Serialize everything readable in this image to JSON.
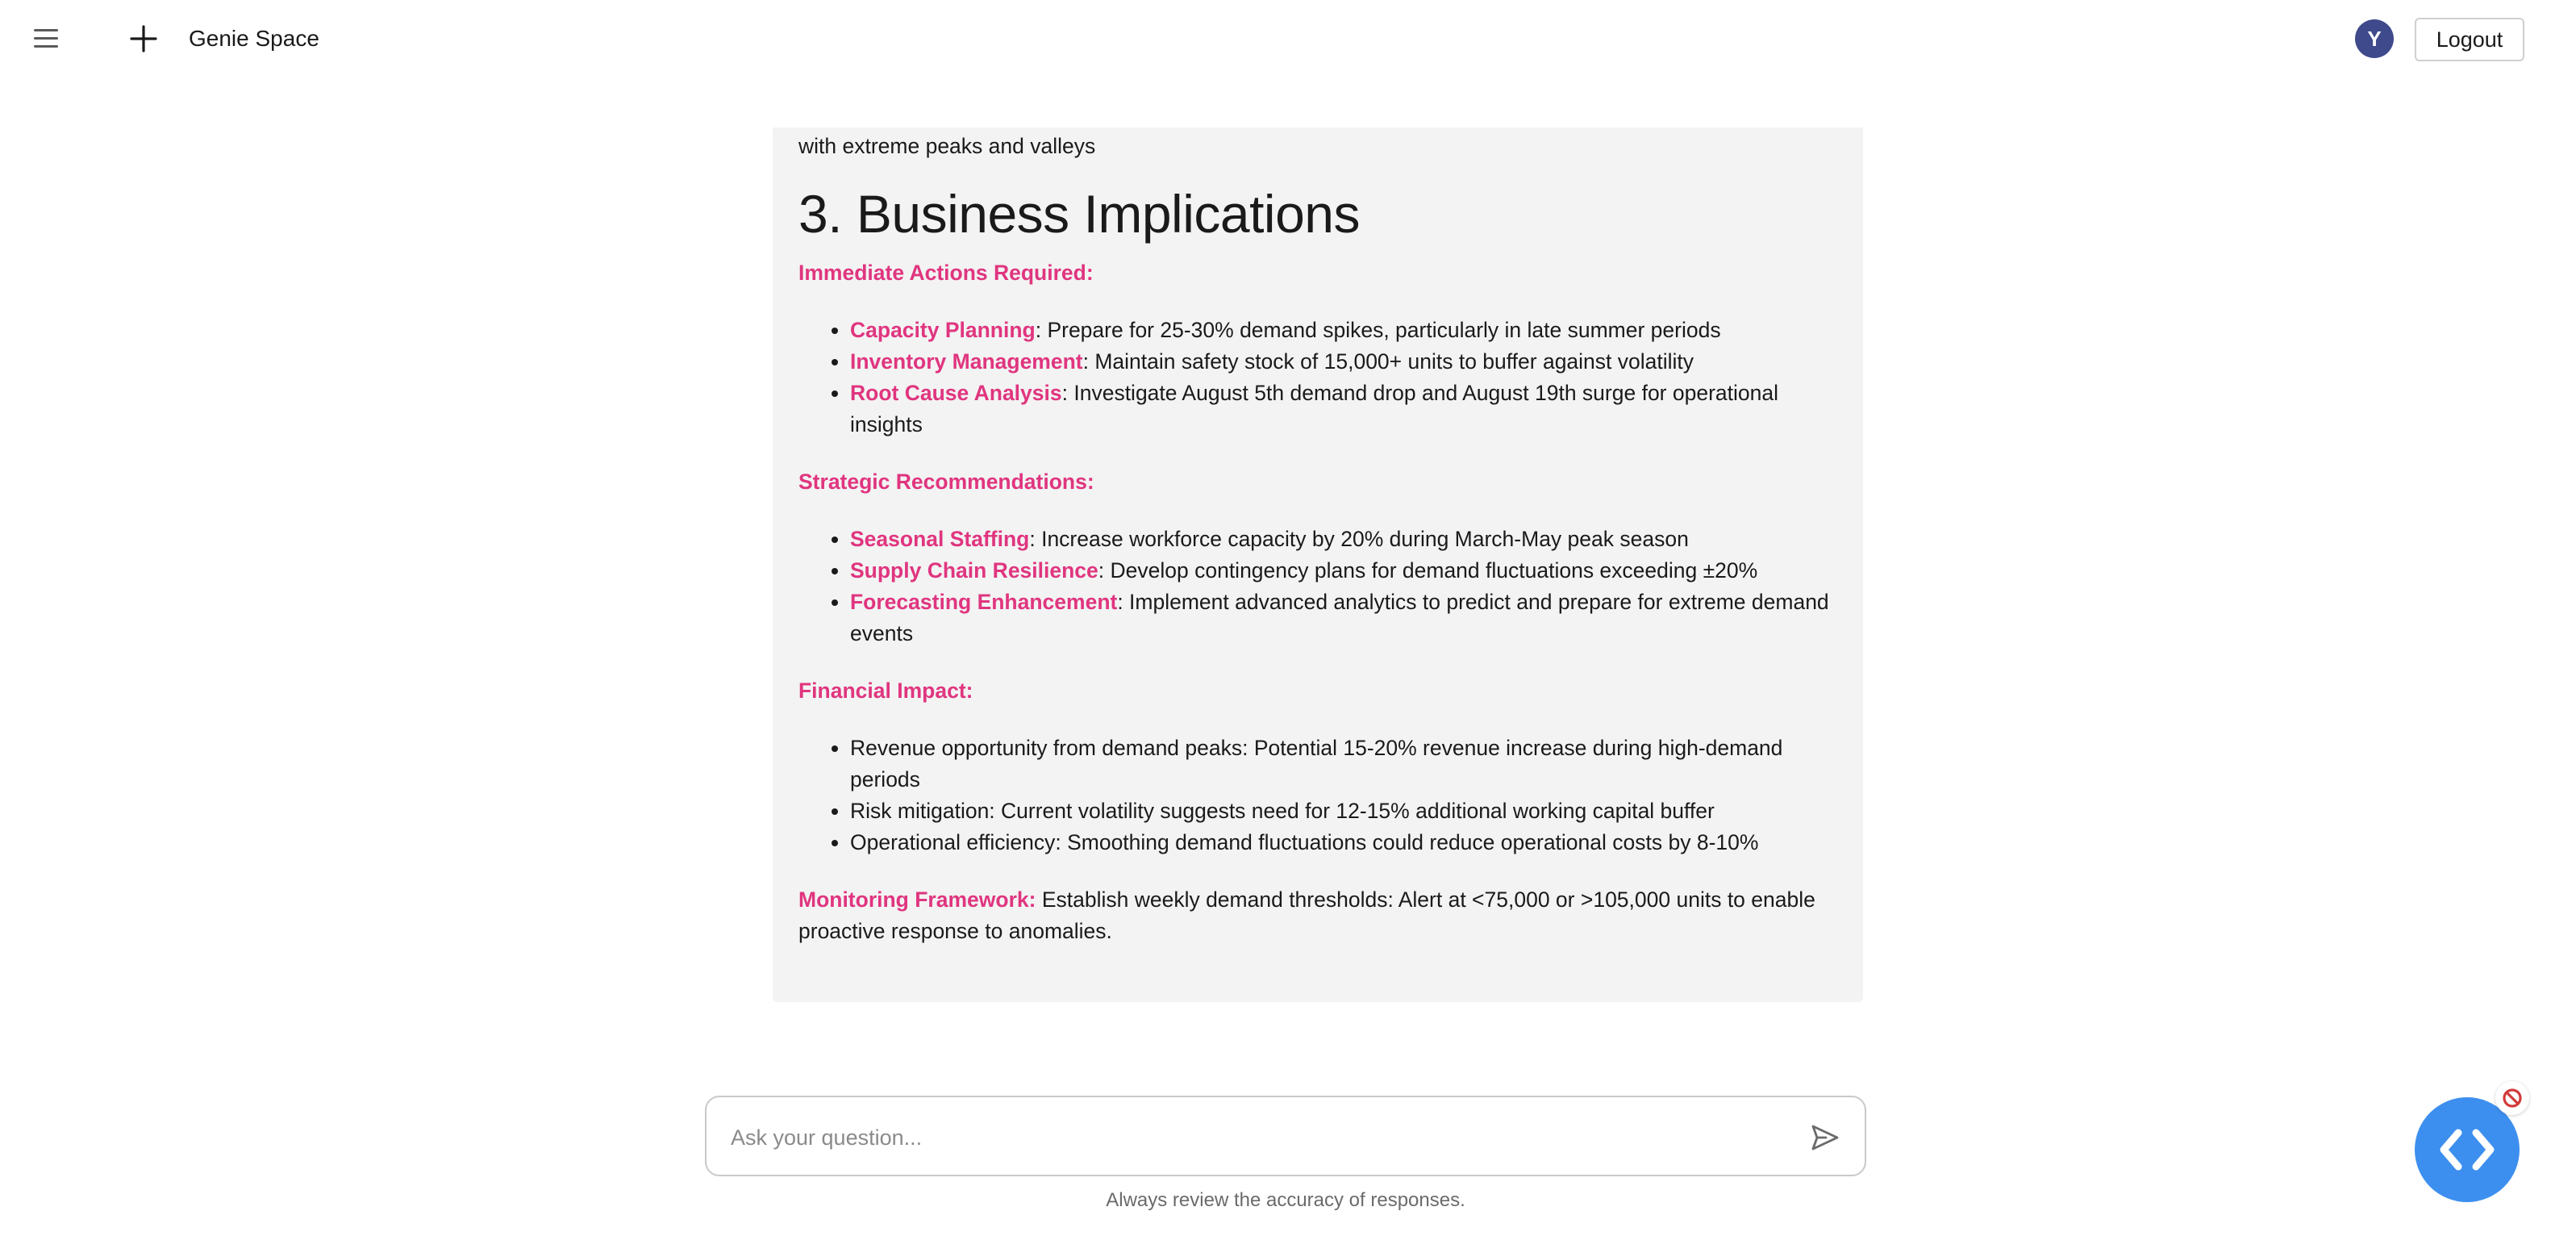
{
  "header": {
    "app_title": "Genie Space",
    "avatar_initial": "Y",
    "logout_label": "Logout"
  },
  "answer": {
    "top_line": "with extreme peaks and valleys",
    "section_title": "3. Business Implications",
    "immediate": {
      "heading": "Immediate Actions Required:",
      "items": [
        {
          "label": "Capacity Planning",
          "text": ": Prepare for 25-30% demand spikes, particularly in late summer periods"
        },
        {
          "label": "Inventory Management",
          "text": ": Maintain safety stock of 15,000+ units to buffer against volatility"
        },
        {
          "label": "Root Cause Analysis",
          "text": ": Investigate August 5th demand drop and August 19th surge for operational insights"
        }
      ]
    },
    "strategic": {
      "heading": "Strategic Recommendations:",
      "items": [
        {
          "label": "Seasonal Staffing",
          "text": ": Increase workforce capacity by 20% during March-May peak season"
        },
        {
          "label": "Supply Chain Resilience",
          "text": ": Develop contingency plans for demand fluctuations exceeding ±20%"
        },
        {
          "label": "Forecasting Enhancement",
          "text": ": Implement advanced analytics to predict and prepare for extreme demand events"
        }
      ]
    },
    "financial": {
      "heading": "Financial Impact:",
      "items": [
        "Revenue opportunity from demand peaks: Potential 15-20% revenue increase during high-demand periods",
        "Risk mitigation: Current volatility suggests need for 12-15% additional working capital buffer",
        "Operational efficiency: Smoothing demand fluctuations could reduce operational costs by 8-10%"
      ]
    },
    "monitoring": {
      "label": "Monitoring Framework:",
      "text": " Establish weekly demand thresholds: Alert at <75,000 or >105,000 units to enable proactive response to anomalies."
    }
  },
  "composer": {
    "placeholder": "Ask your question...",
    "disclaimer": "Always review the accuracy of responses."
  },
  "icons": {
    "menu": "hamburger-menu-icon",
    "new_chat": "plus-icon",
    "send": "send-icon",
    "widget": "code-brackets-icon",
    "widget_badge": "prohibited-icon"
  },
  "colors": {
    "accent_pink": "#e0357f",
    "avatar_bg": "#3f4a8c",
    "fab_blue": "#3d8fef",
    "card_bg": "#f3f3f3"
  }
}
